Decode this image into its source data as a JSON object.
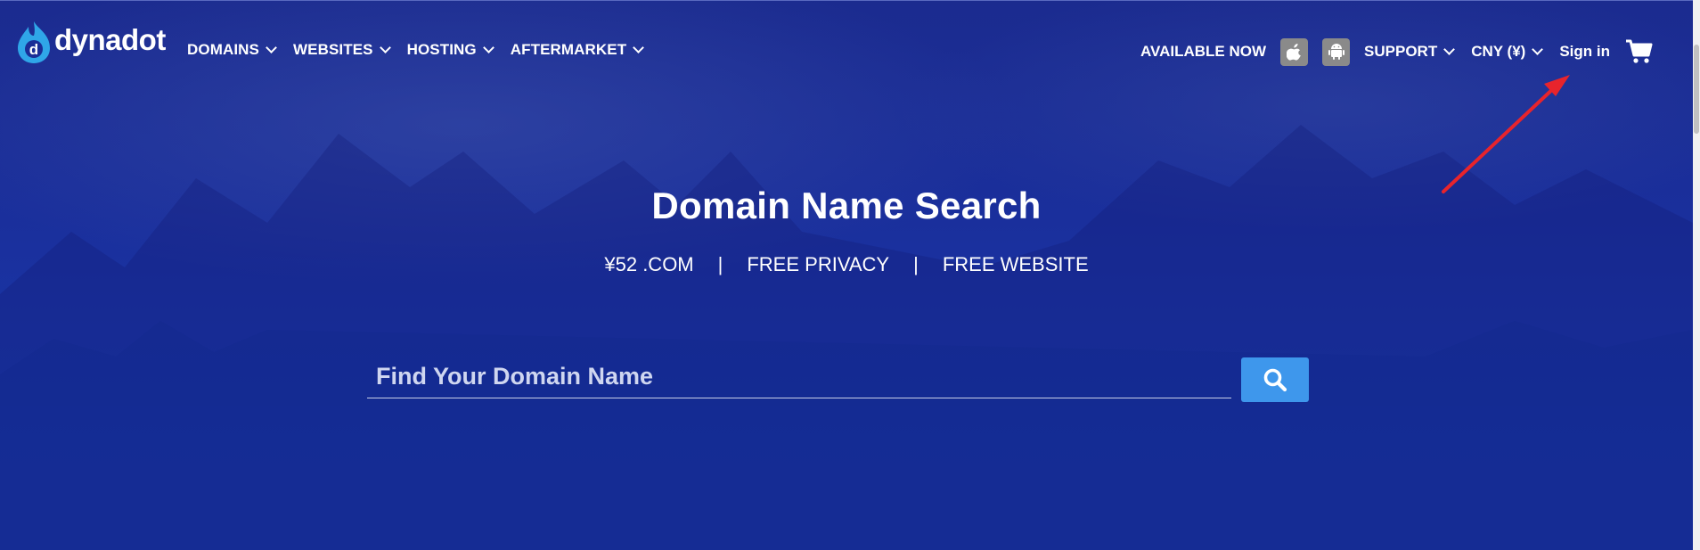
{
  "brand": {
    "name": "dynadot"
  },
  "nav": {
    "items": [
      {
        "label": "DOMAINS"
      },
      {
        "label": "WEBSITES"
      },
      {
        "label": "HOSTING"
      },
      {
        "label": "AFTERMARKET"
      }
    ]
  },
  "right_nav": {
    "available_now": "AVAILABLE NOW",
    "apple_icon": "apple-icon",
    "android_icon": "android-icon",
    "support": "SUPPORT",
    "currency": "CNY (¥)",
    "sign_in": "Sign in",
    "cart_icon": "cart-icon"
  },
  "hero": {
    "title": "Domain Name Search",
    "features": [
      "¥52 .COM",
      "FREE PRIVACY",
      "FREE WEBSITE"
    ],
    "separator": "|"
  },
  "search": {
    "placeholder": "Find Your Domain Name",
    "value": "",
    "button_icon": "search-icon"
  },
  "colors": {
    "background": "#1a2d96",
    "search_button": "#3e97ec",
    "app_button": "#8a8a8a",
    "annotation_arrow": "#e8242c"
  }
}
